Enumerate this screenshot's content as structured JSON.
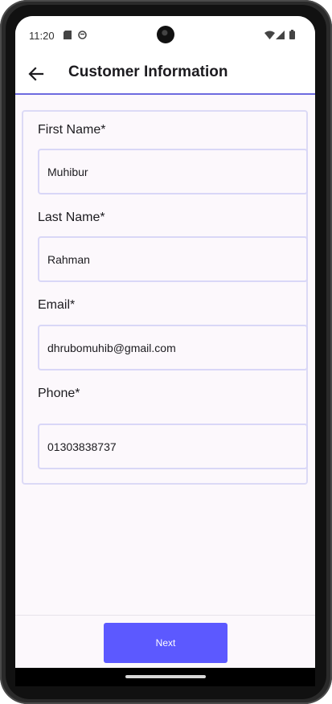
{
  "status_bar": {
    "time": "11:20",
    "icons": [
      "sd-card-icon",
      "face-icon",
      "wifi-icon",
      "signal-icon",
      "battery-icon"
    ]
  },
  "app_bar": {
    "back_icon": "arrow-left-icon",
    "title": "Customer Information",
    "accent_color": "#6d6adf"
  },
  "form": {
    "fields": [
      {
        "label": "First Name*",
        "value": "Muhibur"
      },
      {
        "label": "Last Name*",
        "value": "Rahman"
      },
      {
        "label": "Email*",
        "value": "dhrubomuhib@gmail.com"
      },
      {
        "label": "Phone*",
        "value": "01303838737"
      }
    ]
  },
  "footer": {
    "next_label": "Next",
    "button_color": "#5c59ff"
  }
}
